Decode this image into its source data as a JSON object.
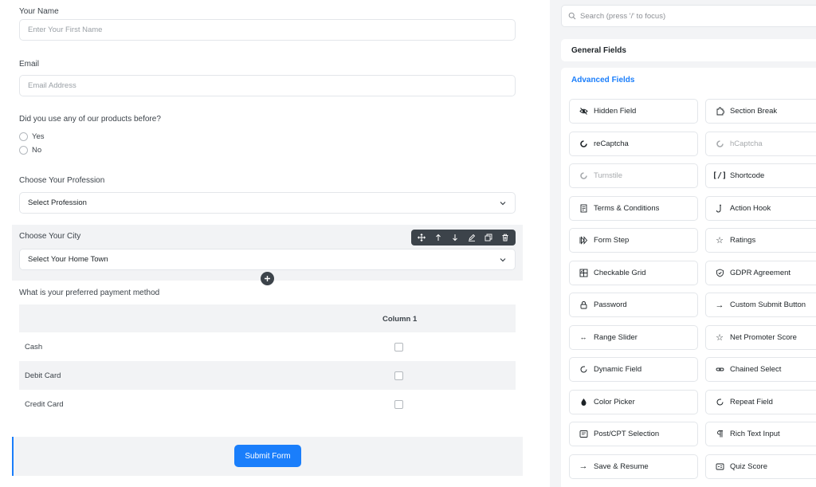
{
  "form": {
    "name": {
      "label": "Your Name",
      "placeholder": "Enter Your First Name"
    },
    "email": {
      "label": "Email",
      "placeholder": "Email Address"
    },
    "products": {
      "label": "Did you use any of our products before?",
      "options": [
        "Yes",
        "No"
      ]
    },
    "profession": {
      "label": "Choose Your Profession",
      "selected": "Select Profession"
    },
    "city": {
      "label": "Choose Your City",
      "selected": "Select Your Home Town"
    },
    "payment": {
      "label": "What is your preferred payment method",
      "column": "Column 1",
      "rows": [
        "Cash",
        "Debit Card",
        "Credit Card"
      ]
    },
    "submit_label": "Submit Form"
  },
  "toolbar": {
    "icons": [
      "move-icon",
      "arrow-up-icon",
      "arrow-down-icon",
      "edit-icon",
      "duplicate-icon",
      "trash-icon"
    ]
  },
  "panel": {
    "search_placeholder": "Search (press '/' to focus)",
    "general_title": "General Fields",
    "advanced_title": "Advanced Fields",
    "accent": "#1a7efb",
    "fields": [
      {
        "label": "Hidden Field",
        "icon": "eye-slash-icon"
      },
      {
        "label": "Section Break",
        "icon": "puzzle-icon"
      },
      {
        "label": "reCaptcha",
        "icon": "recaptcha-icon"
      },
      {
        "label": "hCaptcha",
        "icon": "hcaptcha-icon"
      },
      {
        "label": "Turnstile",
        "icon": "turnstile-icon"
      },
      {
        "label": "Shortcode",
        "icon": "shortcode-icon"
      },
      {
        "label": "Terms & Conditions",
        "icon": "document-icon"
      },
      {
        "label": "Action Hook",
        "icon": "hook-icon"
      },
      {
        "label": "Form Step",
        "icon": "step-forward-icon"
      },
      {
        "label": "Ratings",
        "icon": "star-icon"
      },
      {
        "label": "Checkable Grid",
        "icon": "grid-icon"
      },
      {
        "label": "GDPR Agreement",
        "icon": "shield-icon"
      },
      {
        "label": "Password",
        "icon": "lock-icon"
      },
      {
        "label": "Custom Submit Button",
        "icon": "arrow-right-icon"
      },
      {
        "label": "Range Slider",
        "icon": "range-icon"
      },
      {
        "label": "Net Promoter Score",
        "icon": "star-outline-icon"
      },
      {
        "label": "Dynamic Field",
        "icon": "refresh-icon"
      },
      {
        "label": "Chained Select",
        "icon": "link-icon"
      },
      {
        "label": "Color Picker",
        "icon": "droplet-icon"
      },
      {
        "label": "Repeat Field",
        "icon": "repeat-icon"
      },
      {
        "label": "Post/CPT Selection",
        "icon": "post-icon"
      },
      {
        "label": "Rich Text Input",
        "icon": "paragraph-icon"
      },
      {
        "label": "Save & Resume",
        "icon": "arrow-right-icon"
      },
      {
        "label": "Quiz Score",
        "icon": "quiz-icon"
      }
    ]
  }
}
